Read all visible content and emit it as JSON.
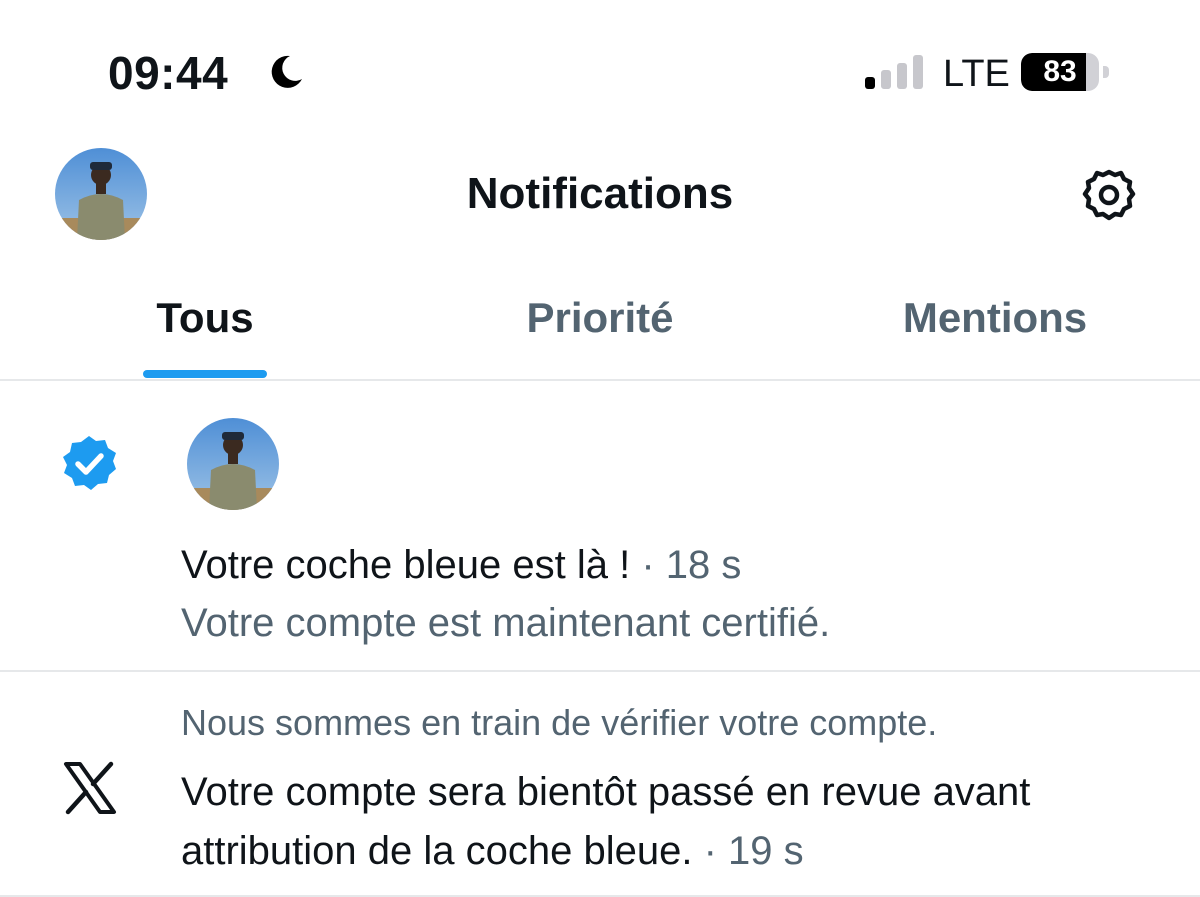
{
  "status_bar": {
    "time": "09:44",
    "network": "LTE",
    "battery_percent": "83",
    "battery_level": 0.83,
    "signal_bars_active": 1,
    "signal_bars_total": 4,
    "icons": [
      "moon-icon",
      "signal-icon",
      "battery-icon"
    ]
  },
  "header": {
    "title": "Notifications",
    "left_icon": "avatar",
    "right_icon": "gear-icon"
  },
  "tabs": [
    {
      "label": "Tous",
      "active": true
    },
    {
      "label": "Priorité",
      "active": false
    },
    {
      "label": "Mentions",
      "active": false
    }
  ],
  "notifications": [
    {
      "icon": "verified-badge-icon",
      "title": "Votre coche bleue est là !",
      "time": "· 18 s",
      "subtitle": "Votre compte est maintenant certifié."
    },
    {
      "icon": "x-logo-icon",
      "kicker": "Nous sommes en train de vérifier votre compte.",
      "body": "Votre compte sera bientôt passé en revue avant attribution de la coche bleue.",
      "time": "· 19 s"
    }
  ],
  "colors": {
    "accent": "#1d9bf0",
    "text_primary": "#0f1419",
    "text_secondary": "#536471",
    "divider": "#e6e8ea"
  }
}
